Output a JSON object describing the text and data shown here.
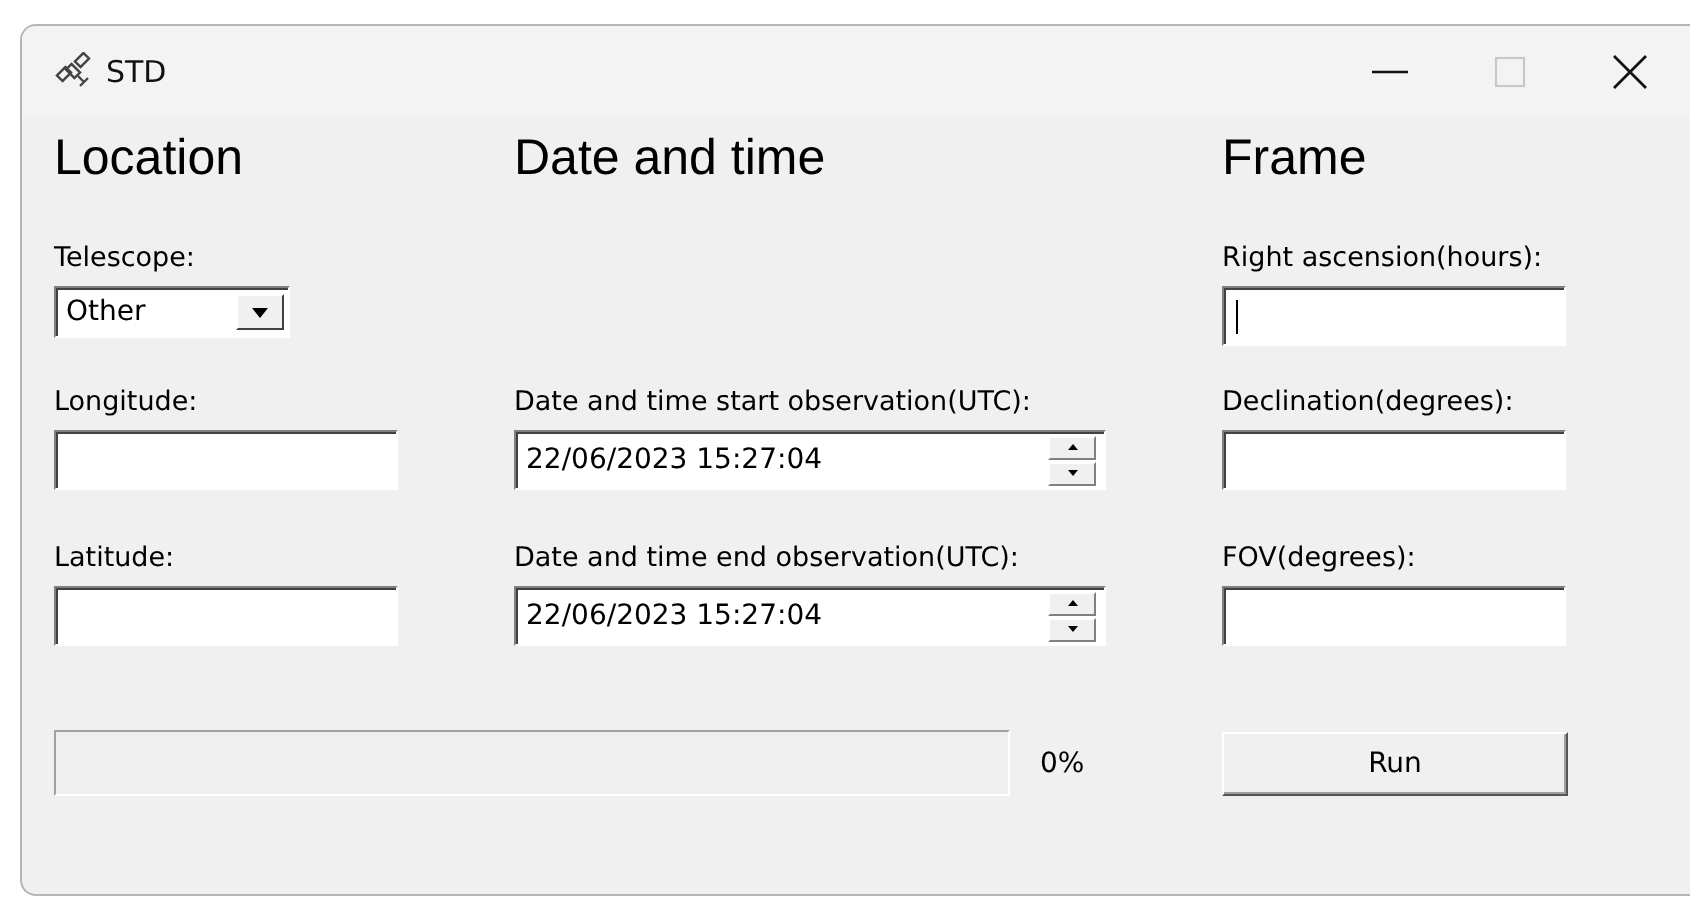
{
  "window": {
    "title": "STD",
    "maximize_disabled": true
  },
  "location": {
    "title": "Location",
    "telescope": {
      "label": "Telescope:",
      "value": "Other"
    },
    "longitude": {
      "label": "Longitude:"
    },
    "latitude": {
      "label": "Latitude:"
    }
  },
  "date_time": {
    "title": "Date and time",
    "start": {
      "label": "Date and time start observation(UTC):",
      "value": "22/06/2023 15:27:04"
    },
    "end": {
      "label": "Date and time end observation(UTC):",
      "value": "22/06/2023 15:27:04"
    }
  },
  "frame": {
    "title": "Frame",
    "right_ascension": {
      "label": "Right ascension(hours):",
      "focused": true
    },
    "declination": {
      "label": "Declination(degrees):",
      "focused": false
    },
    "fov": {
      "label": "FOV(degrees):",
      "focused": false
    }
  },
  "progress": {
    "level": 0,
    "reading": "0%"
  },
  "run_button": {
    "label": "Run"
  }
}
